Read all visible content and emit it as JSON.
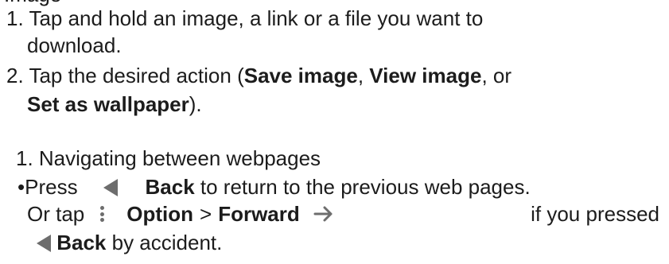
{
  "clipped_top_text": "Image",
  "steps": [
    {
      "num": "1.",
      "line1": "Tap and hold an image, a link or a file you want to",
      "line2": "download."
    },
    {
      "num": "2.",
      "line1_pre": "Tap the desired action (",
      "save_image": "Save image",
      "sep1": ", ",
      "view_image": "View image",
      "sep2": ", or",
      "set_as_wallpaper": "Set as wallpaper",
      "tail": ")."
    }
  ],
  "section": {
    "heading": "1. Navigating between webpages",
    "bullet": "•",
    "press": "Press",
    "back_label": "Back",
    "back_text": " to return to the previous web pages.",
    "or_tap": "Or tap",
    "option_label": "Option",
    "gt": ">",
    "forward_label": "Forward",
    "if_pressed": "if you pressed",
    "by_accident": " by accident."
  },
  "icons": {
    "back": "back-triangle-icon",
    "option": "more-vert-icon",
    "forward": "arrow-forward-icon",
    "color": "#6d6d6d"
  }
}
